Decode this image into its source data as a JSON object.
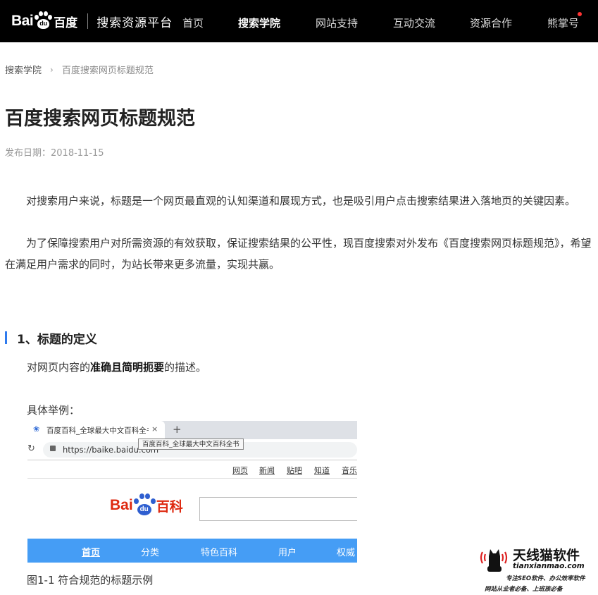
{
  "header": {
    "logo_bai": "Bai",
    "logo_paw_text": "du",
    "logo_cn": "百度",
    "platform": "搜索资源平台",
    "nav": [
      {
        "label": "首页"
      },
      {
        "label": "搜索学院",
        "active": true
      },
      {
        "label": "网站支持"
      },
      {
        "label": "互动交流"
      },
      {
        "label": "资源合作"
      },
      {
        "label": "熊掌号"
      }
    ],
    "notification_dot_color": "#ff3333"
  },
  "breadcrumb": {
    "parent": "搜索学院",
    "separator": "›",
    "current": "百度搜索网页标题规范"
  },
  "article": {
    "title": "百度搜索网页标题规范",
    "date": "发布日期：2018-11-15",
    "paragraphs": [
      "对搜索用户来说，标题是一个网页最直观的认知渠道和展现方式，也是吸引用户点击搜索结果进入落地页的关键因素。",
      "为了保障搜索用户对所需资源的有效获取，保证搜索结果的公平性，现百度搜索对外发布《百度搜索网页标题规范》，希望在满足用户需求的同时，为站长带来更多流量，实现共赢。"
    ],
    "section_title": "1、标题的定义",
    "definition_prefix": "对网页内容的",
    "definition_bold": "准确且简明扼要",
    "definition_suffix": "的描述。",
    "example_label": "具体举例：",
    "accent_color": "#2f7bee"
  },
  "screenshot": {
    "tab_title": "百度百科_全球最大中文百科全书",
    "tab_close": "×",
    "tab_new": "+",
    "tooltip": "百度百科_全球最大中文百科全书",
    "url": "https://baike.baidu.com",
    "links": [
      "网页",
      "新闻",
      "贴吧",
      "知道",
      "音乐"
    ],
    "logo_bai": "Bai",
    "logo_paw_text": "du",
    "logo_cn": "百科",
    "nav": [
      {
        "label": "首页",
        "active": true
      },
      {
        "label": "分类"
      },
      {
        "label": "特色百科"
      },
      {
        "label": "用户"
      },
      {
        "label": "权威"
      }
    ],
    "nav_color": "#459df5",
    "logo_color": "#de2910"
  },
  "caption": "图1-1 符合规范的标题示例",
  "watermark": {
    "brand": "天线猫软件",
    "site": "tianxianmao.com",
    "line1": "专注SEO软件、办公效率软件",
    "line2": "网站从业者必备、上班族必备"
  }
}
